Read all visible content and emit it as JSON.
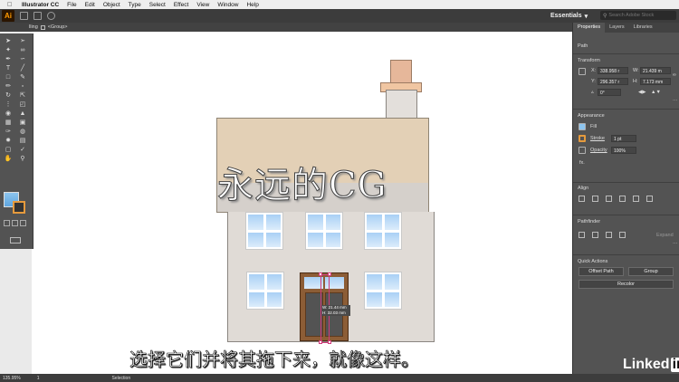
{
  "menubar": {
    "app_name": "Illustrator CC",
    "items": [
      "File",
      "Edit",
      "Object",
      "Type",
      "Select",
      "Effect",
      "View",
      "Window",
      "Help"
    ]
  },
  "appbar": {
    "logo": "Ai",
    "workspace": "Essentials",
    "search_placeholder": "Search Adobe Stock"
  },
  "document": {
    "tab_partial": "lling",
    "breadcrumb": "<Group>"
  },
  "canvas": {
    "tooltip_w": "W: 21.44 mm",
    "tooltip_h": "H: 32.03 mm"
  },
  "overlay": {
    "watermark": "永远的CG",
    "subtitle": "选择它们并将其拖下来，就像这样。"
  },
  "panel": {
    "tabs": [
      "Properties",
      "Layers",
      "Libraries"
    ],
    "object_type": "Path",
    "transform": {
      "title": "Transform",
      "x": "338.958 r",
      "y": "296.357 r",
      "w": "21.439 m",
      "h": "7.173 mm",
      "angle": "0°"
    },
    "appearance": {
      "title": "Appearance",
      "fill_label": "Fill",
      "stroke_label": "Stroke",
      "stroke_weight": "1 pt",
      "opacity_label": "Opacity",
      "opacity_value": "100%",
      "fx_label": "fx."
    },
    "align_title": "Align",
    "pathfinder": {
      "title": "Pathfinder",
      "expand_label": "Expand"
    },
    "quick_actions": {
      "title": "Quick Actions",
      "offset_path": "Offset Path",
      "group": "Group",
      "recolor": "Recolor"
    }
  },
  "branding": {
    "linked": "Linked",
    "in": "in"
  },
  "statusbar": {
    "zoom": "135.95%",
    "page": "1",
    "tool": "Selection"
  },
  "colors": {
    "accent": "#ff9a00",
    "selection": "#d13a7a",
    "roof": "#e3d0b6",
    "door": "#8c5d36"
  }
}
